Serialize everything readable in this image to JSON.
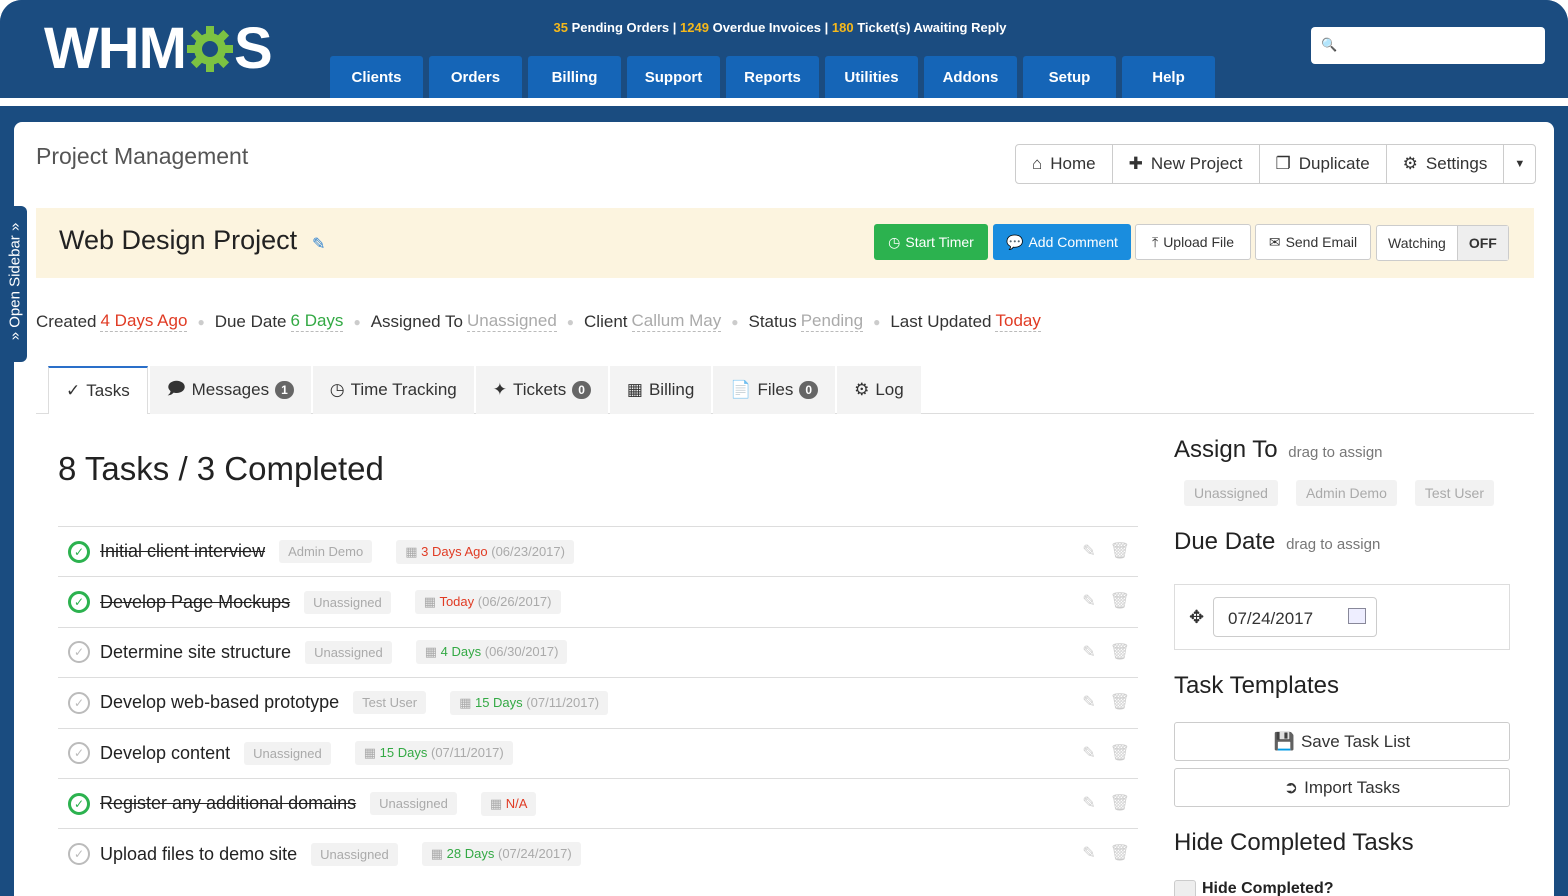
{
  "header": {
    "logo_text_a": "WHM",
    "logo_text_b": "S",
    "stats": {
      "pending_orders_count": "35",
      "pending_orders_label": "Pending Orders",
      "overdue_invoices_count": "1249",
      "overdue_invoices_label": "Overdue Invoices",
      "tickets_count": "180",
      "tickets_label": "Ticket(s) Awaiting Reply",
      "separator": "|"
    },
    "search_placeholder": ""
  },
  "nav": [
    "Clients",
    "Orders",
    "Billing",
    "Support",
    "Reports",
    "Utilities",
    "Addons",
    "Setup",
    "Help"
  ],
  "sidebar_tab": "» Open Sidebar »",
  "page_title": "Project Management",
  "top_buttons": {
    "home": "Home",
    "new_project": "New Project",
    "duplicate": "Duplicate",
    "settings": "Settings"
  },
  "project": {
    "name": "Web Design Project",
    "start_timer": "Start Timer",
    "add_comment": "Add Comment",
    "upload_file": "Upload File",
    "send_email": "Send Email",
    "watching_label": "Watching",
    "watching_state": "OFF"
  },
  "meta": {
    "created_label": "Created",
    "created_value": "4 Days Ago",
    "due_label": "Due Date",
    "due_value": "6 Days",
    "assigned_label": "Assigned To",
    "assigned_value": "Unassigned",
    "client_label": "Client",
    "client_value": "Callum May",
    "status_label": "Status",
    "status_value": "Pending",
    "updated_label": "Last Updated",
    "updated_value": "Today"
  },
  "tabs": [
    {
      "label": "Tasks",
      "badge": ""
    },
    {
      "label": "Messages",
      "badge": "1"
    },
    {
      "label": "Time Tracking",
      "badge": ""
    },
    {
      "label": "Tickets",
      "badge": "0"
    },
    {
      "label": "Billing",
      "badge": ""
    },
    {
      "label": "Files",
      "badge": "0"
    },
    {
      "label": "Log",
      "badge": ""
    }
  ],
  "tasks_heading": "8 Tasks / 3 Completed",
  "tasks": [
    {
      "name": "Initial client interview",
      "assignee": "Admin Demo",
      "due_rel": "3 Days Ago",
      "due_date": "(06/23/2017)",
      "due_color": "#e03b24",
      "done": true
    },
    {
      "name": "Develop Page Mockups",
      "assignee": "Unassigned",
      "due_rel": "Today",
      "due_date": "(06/26/2017)",
      "due_color": "#e03b24",
      "done": true
    },
    {
      "name": "Determine site structure",
      "assignee": "Unassigned",
      "due_rel": "4 Days",
      "due_date": "(06/30/2017)",
      "due_color": "#33a944",
      "done": false
    },
    {
      "name": "Develop web-based prototype",
      "assignee": "Test User",
      "due_rel": "15 Days",
      "due_date": "(07/11/2017)",
      "due_color": "#33a944",
      "done": false
    },
    {
      "name": "Develop content",
      "assignee": "Unassigned",
      "due_rel": "15 Days",
      "due_date": "(07/11/2017)",
      "due_color": "#33a944",
      "done": false
    },
    {
      "name": "Register any additional domains",
      "assignee": "Unassigned",
      "due_rel": "N/A",
      "due_date": "",
      "due_color": "#e03b24",
      "done": true
    },
    {
      "name": "Upload files to demo site",
      "assignee": "Unassigned",
      "due_rel": "28 Days",
      "due_date": "(07/24/2017)",
      "due_color": "#33a944",
      "done": false
    }
  ],
  "right": {
    "assign_heading": "Assign To",
    "assign_hint": "drag to assign",
    "assignees": [
      "Unassigned",
      "Admin Demo",
      "Test User"
    ],
    "due_heading": "Due Date",
    "due_hint": "drag to assign",
    "due_value": "07/24/2017",
    "templates_heading": "Task Templates",
    "save_task_list": "Save Task List",
    "import_tasks": "Import Tasks",
    "hide_heading": "Hide Completed Tasks",
    "hide_label": "Hide Completed?"
  }
}
